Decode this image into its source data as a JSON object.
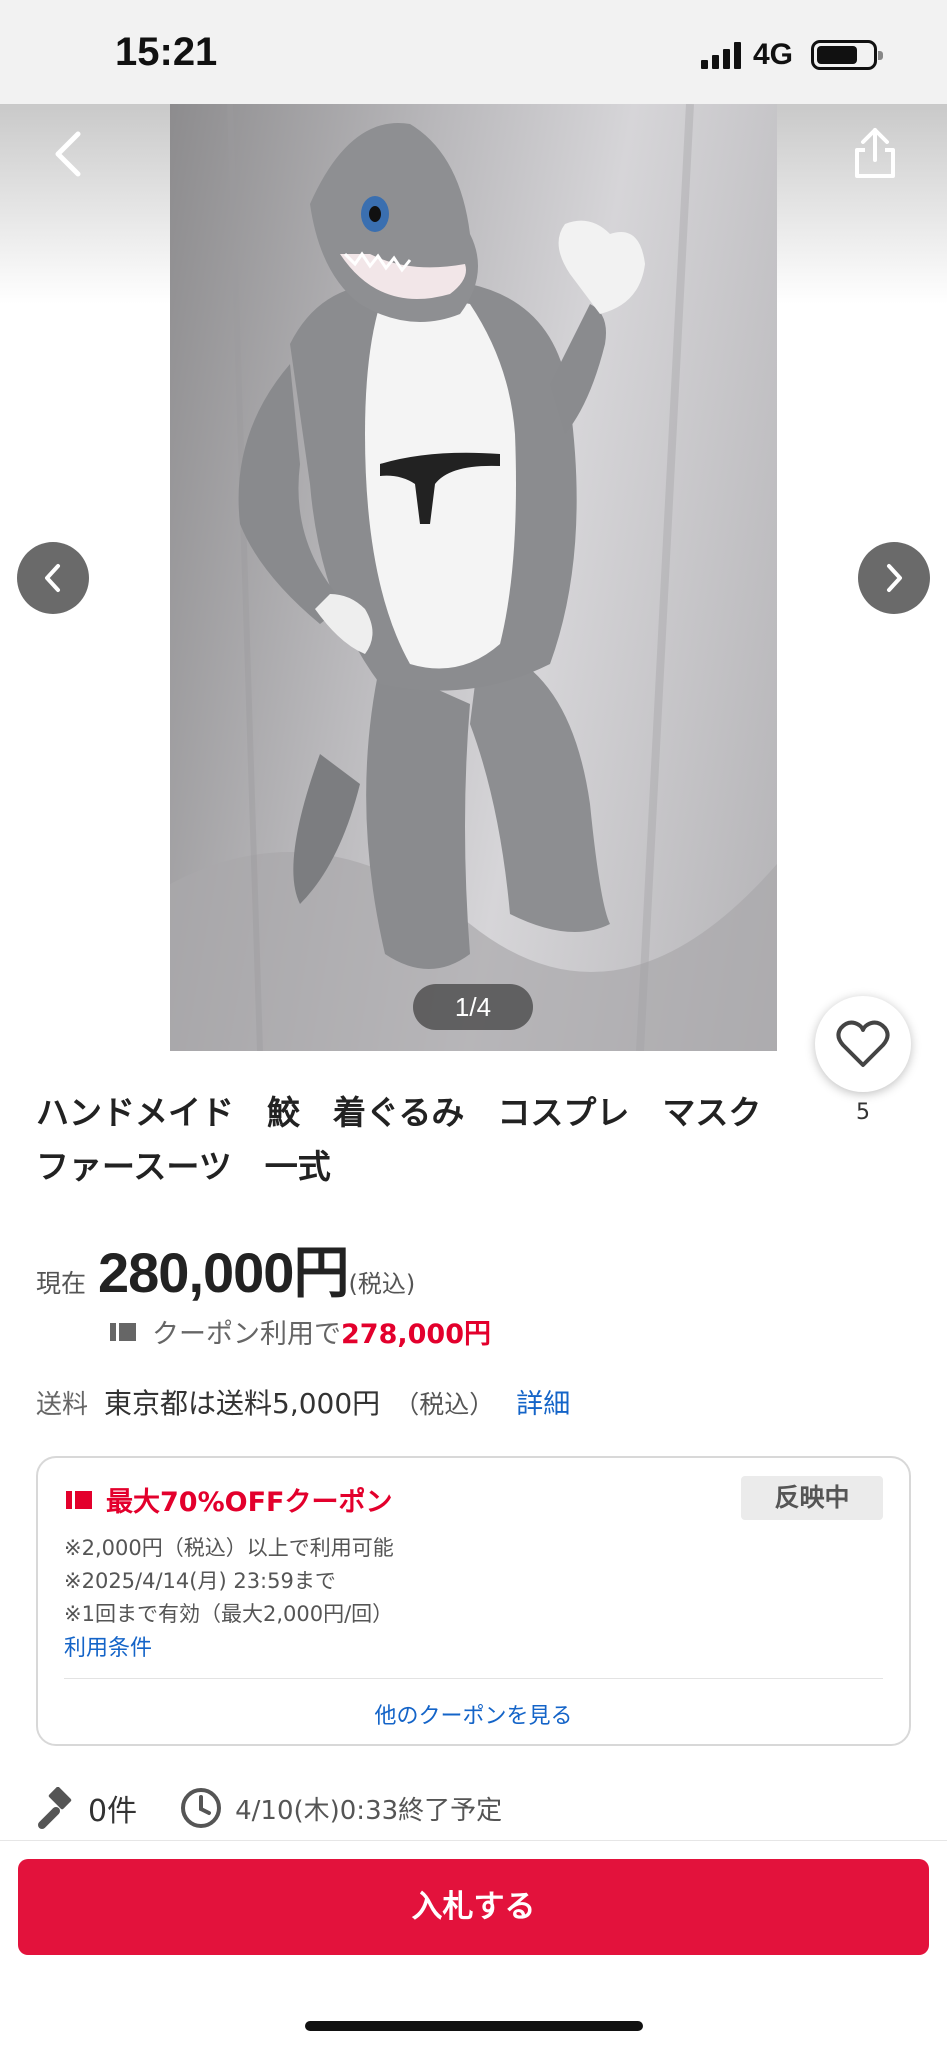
{
  "status_bar": {
    "time": "15:21",
    "network": "4G"
  },
  "gallery": {
    "counter": "1/4",
    "icons": [
      "back-arrow-icon",
      "share-icon",
      "chevron-left-icon",
      "chevron-right-icon"
    ]
  },
  "favorite": {
    "count": "5"
  },
  "product": {
    "title": "ハンドメイド　鮫　着ぐるみ　コスプレ　マスク　ファースーツ　一式",
    "price_label": "現在",
    "price": "280,000円",
    "price_tax": "(税込)",
    "coupon_prefix": "クーポン利用で",
    "coupon_price": "278,000円"
  },
  "shipping": {
    "label": "送料",
    "text": "東京都は送料5,000円",
    "tax": "（税込）",
    "detail_link": "詳細"
  },
  "coupon_card": {
    "title": "最大70%OFFクーポン",
    "badge": "反映中",
    "notes": [
      "※2,000円（税込）以上で利用可能",
      "※2025/4/14(月) 23:59まで",
      "※1回まで有効（最大2,000円/回）"
    ],
    "terms_link": "利用条件",
    "more_link": "他のクーポンを見る"
  },
  "auction": {
    "bids": "0件",
    "end_time": "4/10(木)0:33終了予定"
  },
  "bid_button": {
    "label": "入札する"
  },
  "colors": {
    "accent_red": "#e3123c",
    "link_blue": "#1464c8",
    "price_red": "#e3002c"
  }
}
